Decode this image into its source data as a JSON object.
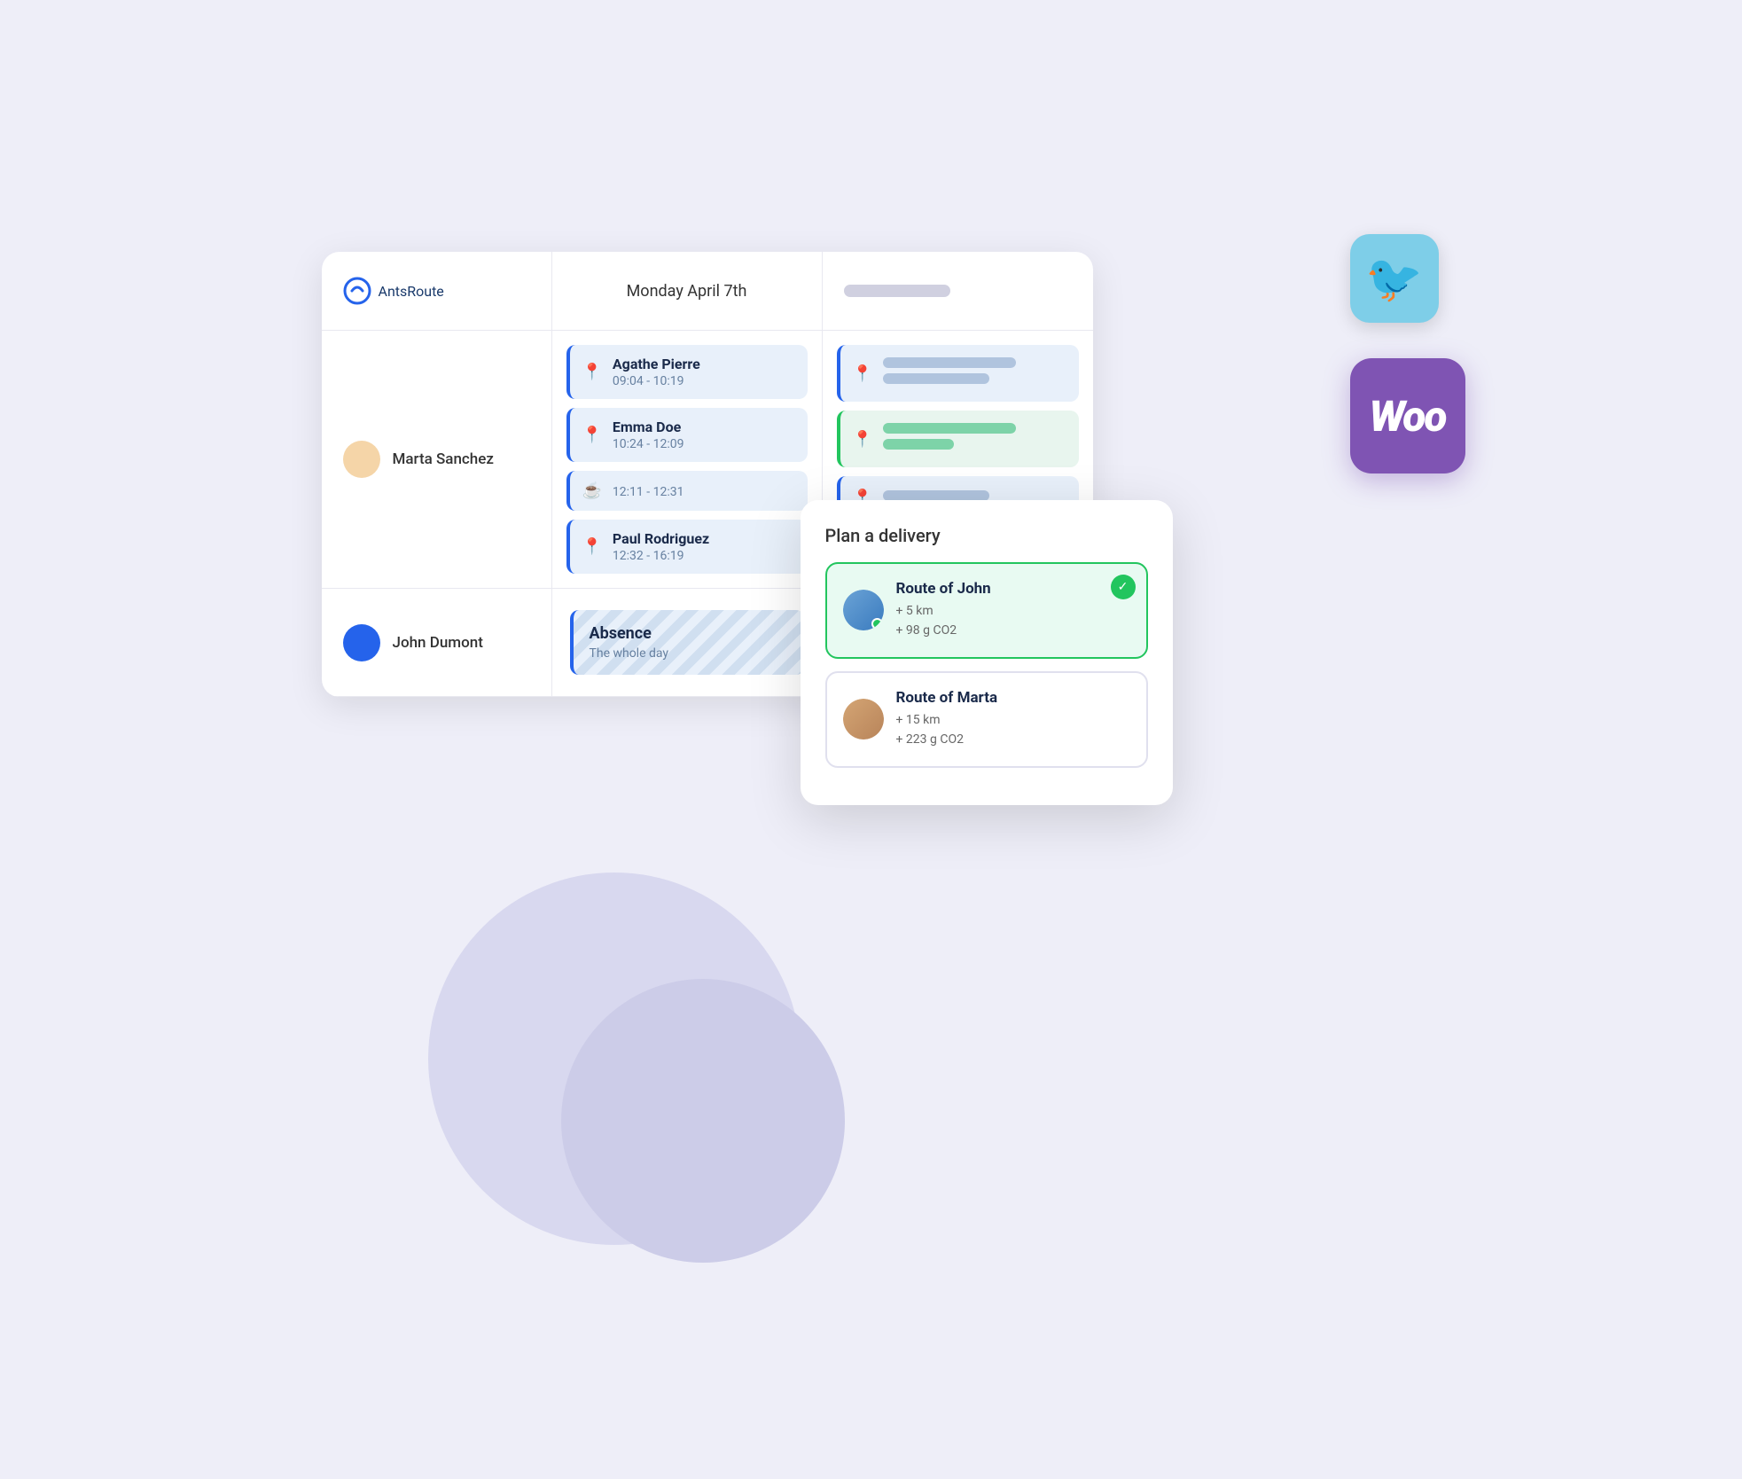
{
  "app": {
    "logo_ants": "Ants",
    "logo_route": "Route",
    "title": "AntsRoute"
  },
  "header": {
    "date": "Monday April 7th",
    "placeholder": ""
  },
  "persons": [
    {
      "name": "Marta Sanchez",
      "avatar_color": "#f5d5a8",
      "appointments": [
        {
          "type": "location",
          "name": "Agathe Pierre",
          "time": "09:04 - 10:19"
        },
        {
          "type": "location",
          "name": "Emma Doe",
          "time": "10:24 - 12:09"
        },
        {
          "type": "break",
          "name": "",
          "time": "12:11 - 12:31"
        },
        {
          "type": "location",
          "name": "Paul Rodriguez",
          "time": "12:32 - 16:19"
        }
      ]
    },
    {
      "name": "John Dumont",
      "avatar_color": "#2563eb",
      "appointments": []
    }
  ],
  "absence": {
    "title": "Absence",
    "subtitle": "The whole day"
  },
  "popup": {
    "title": "Plan a delivery",
    "routes": [
      {
        "name": "Route of John",
        "km": "+ 5 km",
        "co2": "+ 98 g CO2",
        "selected": true
      },
      {
        "name": "Route of Marta",
        "km": "+ 15 km",
        "co2": "+ 223 g CO2",
        "selected": false
      }
    ]
  },
  "woo": {
    "label": "Woo"
  },
  "icons": {
    "location": "📍",
    "break": "☕",
    "check": "✓"
  }
}
